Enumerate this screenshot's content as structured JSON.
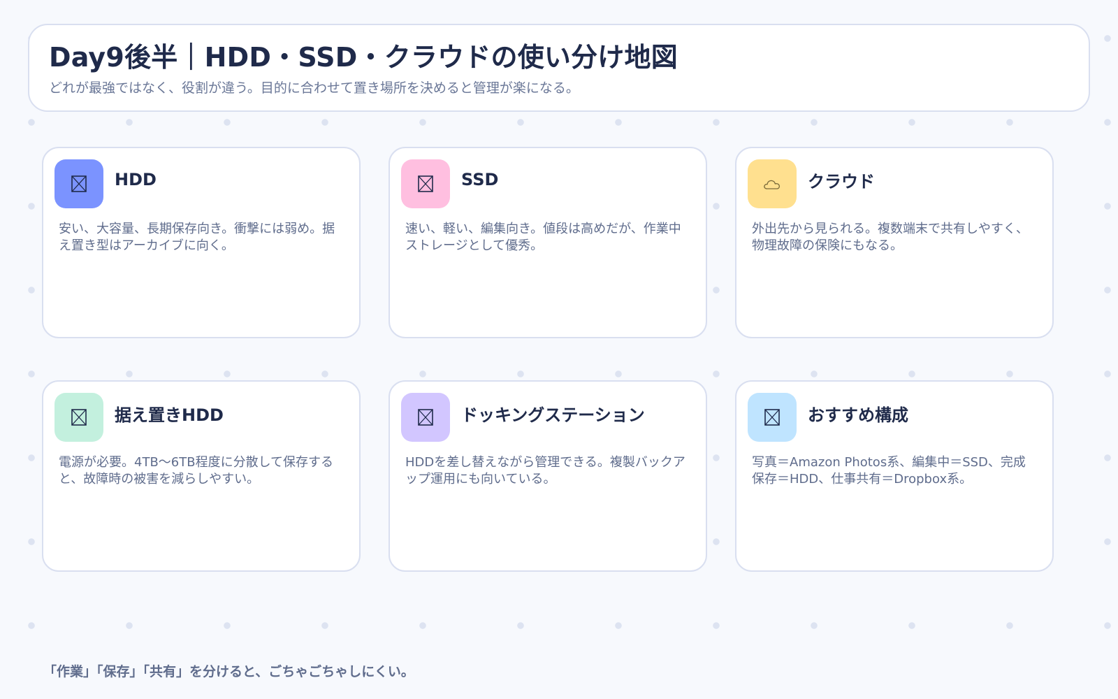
{
  "header": {
    "title": "Day9後半｜HDD・SSD・クラウドの使い分け地図",
    "subtitle": "どれが最強ではなく、役割が違う。目的に合わせて置き場所を決めると管理が楽になる。"
  },
  "cards": [
    {
      "title": "HDD",
      "body": "安い、大容量、長期保存向き。衝撃には弱め。据え置き型はアーカイブに向く。",
      "icon": "hdd-icon",
      "icon_bg": "#7b93ff"
    },
    {
      "title": "SSD",
      "body": "速い、軽い、編集向き。値段は高めだが、作業中ストレージとして優秀。",
      "icon": "ssd-icon",
      "icon_bg": "#ffbfe0"
    },
    {
      "title": "クラウド",
      "body": "外出先から見られる。複数端末で共有しやすく、物理故障の保険にもなる。",
      "icon": "cloud-icon",
      "icon_bg": "#ffe08f"
    },
    {
      "title": "据え置きHDD",
      "body": "電源が必要。4TB〜6TB程度に分散して保存すると、故障時の被害を減らしやすい。",
      "icon": "desktop-hdd-icon",
      "icon_bg": "#c3f0de"
    },
    {
      "title": "ドッキングステーション",
      "body": "HDDを差し替えながら管理できる。複製バックアップ運用にも向いている。",
      "icon": "docking-station-icon",
      "icon_bg": "#d2c6ff"
    },
    {
      "title": "おすすめ構成",
      "body": "写真＝Amazon Photos系、編集中＝SSD、完成保存＝HDD、仕事共有＝Dropbox系。",
      "icon": "recommended-setup-icon",
      "icon_bg": "#bfe4ff"
    }
  ],
  "footer": {
    "note": "「作業」「保存」「共有」を分けると、ごちゃごちゃしにくい。"
  }
}
